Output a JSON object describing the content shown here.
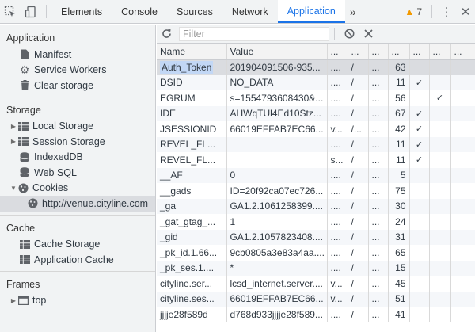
{
  "toolbar": {
    "tabs": [
      "Elements",
      "Console",
      "Sources",
      "Network",
      "Application"
    ],
    "active_tab": "Application",
    "more_tabs": "»",
    "warning_count": "7",
    "kebab": "⋮",
    "close": "✕"
  },
  "sidebar": {
    "application": {
      "title": "Application",
      "items": [
        "Manifest",
        "Service Workers",
        "Clear storage"
      ]
    },
    "storage": {
      "title": "Storage",
      "items": [
        "Local Storage",
        "Session Storage",
        "IndexedDB",
        "Web SQL",
        "Cookies"
      ],
      "cookie_origin": "http://venue.cityline.com"
    },
    "cache": {
      "title": "Cache",
      "items": [
        "Cache Storage",
        "Application Cache"
      ]
    },
    "frames": {
      "title": "Frames",
      "items": [
        "top"
      ]
    }
  },
  "filter": {
    "placeholder": "Filter",
    "value": ""
  },
  "table": {
    "headers": [
      "Name",
      "Value",
      "...",
      "...",
      "...",
      "...",
      "...",
      "...",
      "..."
    ],
    "rows": [
      [
        "Auth_Token",
        "201904091506-935...",
        "....",
        "/",
        "...",
        "63",
        "",
        "",
        ""
      ],
      [
        "DSID",
        "NO_DATA",
        "....",
        "/",
        "...",
        "11",
        "✓",
        "",
        ""
      ],
      [
        "EGRUM",
        "s=1554793608430&...",
        "....",
        "/",
        "...",
        "56",
        "",
        "✓",
        ""
      ],
      [
        "IDE",
        "AHWqTUl4Ed10Stz...",
        "....",
        "/",
        "...",
        "67",
        "✓",
        "",
        ""
      ],
      [
        "JSESSIONID",
        "66019EFFAB7EC66...",
        "v...",
        "/...",
        "...",
        "42",
        "✓",
        "",
        ""
      ],
      [
        "REVEL_FL...",
        "",
        "....",
        "/",
        "...",
        "11",
        "✓",
        "",
        ""
      ],
      [
        "REVEL_FL...",
        "",
        "s...",
        "/",
        "...",
        "11",
        "✓",
        "",
        ""
      ],
      [
        "__AF",
        "0",
        "....",
        "/",
        "...",
        "5",
        "",
        "",
        ""
      ],
      [
        "__gads",
        "ID=20f92ca07ec726...",
        "....",
        "/",
        "...",
        "75",
        "",
        "",
        ""
      ],
      [
        "_ga",
        "GA1.2.1061258399....",
        "....",
        "/",
        "...",
        "30",
        "",
        "",
        ""
      ],
      [
        "_gat_gtag_...",
        "1",
        "....",
        "/",
        "...",
        "24",
        "",
        "",
        ""
      ],
      [
        "_gid",
        "GA1.2.1057823408....",
        "....",
        "/",
        "...",
        "31",
        "",
        "",
        ""
      ],
      [
        "_pk_id.1.66...",
        "9cb0805a3e83a4aa....",
        "....",
        "/",
        "...",
        "65",
        "",
        "",
        ""
      ],
      [
        "_pk_ses.1....",
        "*",
        "....",
        "/",
        "...",
        "15",
        "",
        "",
        ""
      ],
      [
        "cityline.ser...",
        "lcsd_internet.server....",
        "v...",
        "/",
        "...",
        "45",
        "",
        "",
        ""
      ],
      [
        "cityline.ses...",
        "66019EFFAB7EC66...",
        "v...",
        "/",
        "...",
        "51",
        "",
        "",
        ""
      ],
      [
        "jjjje28f589d",
        "d768d933jjjje28f589...",
        "....",
        "/",
        "...",
        "41",
        "",
        "",
        ""
      ]
    ]
  }
}
